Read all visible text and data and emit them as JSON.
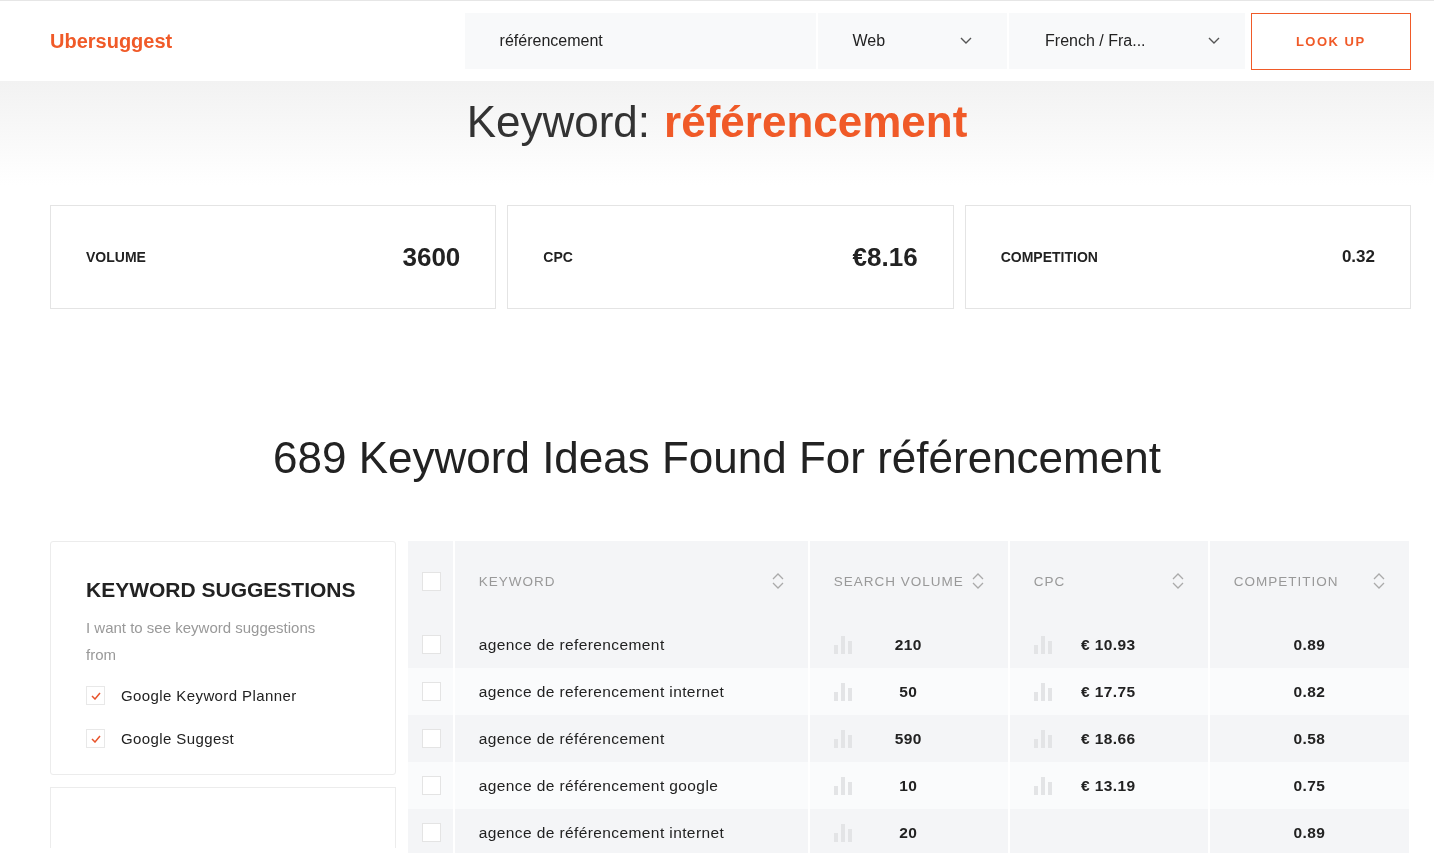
{
  "header": {
    "logo": "Ubersuggest",
    "search": {
      "value": "référencement"
    },
    "source": {
      "value": "Web"
    },
    "language": {
      "value": "French / Fra..."
    },
    "button": "LOOK UP"
  },
  "hero": {
    "label": "Keyword:",
    "keyword": "référencement"
  },
  "stats": [
    {
      "label": "VOLUME",
      "value": "3600"
    },
    {
      "label": "CPC",
      "value": "€8.16"
    },
    {
      "label": "COMPETITION",
      "value": "0.32"
    }
  ],
  "ideas_title": "689 Keyword Ideas Found For référencement",
  "suggestions": {
    "title": "KEYWORD SUGGESTIONS",
    "description": "I want to see keyword suggestions from",
    "options": [
      {
        "label": "Google Keyword Planner",
        "checked": true
      },
      {
        "label": "Google Suggest",
        "checked": true
      }
    ]
  },
  "table": {
    "select_all": {
      "checked": false
    },
    "columns": [
      "KEYWORD",
      "SEARCH VOLUME",
      "CPC",
      "COMPETITION"
    ],
    "rows": [
      {
        "checked": false,
        "keyword": "agence de referencement",
        "volume": "210",
        "cpc": "€ 10.93",
        "competition": "0.89"
      },
      {
        "checked": false,
        "keyword": "agence de referencement internet",
        "volume": "50",
        "cpc": "€ 17.75",
        "competition": "0.82"
      },
      {
        "checked": false,
        "keyword": "agence de référencement",
        "volume": "590",
        "cpc": "€ 18.66",
        "competition": "0.58"
      },
      {
        "checked": false,
        "keyword": "agence de référencement google",
        "volume": "10",
        "cpc": "€ 13.19",
        "competition": "0.75"
      },
      {
        "checked": false,
        "keyword": "agence de référencement internet",
        "volume": "20",
        "competition": "0.89"
      }
    ]
  }
}
